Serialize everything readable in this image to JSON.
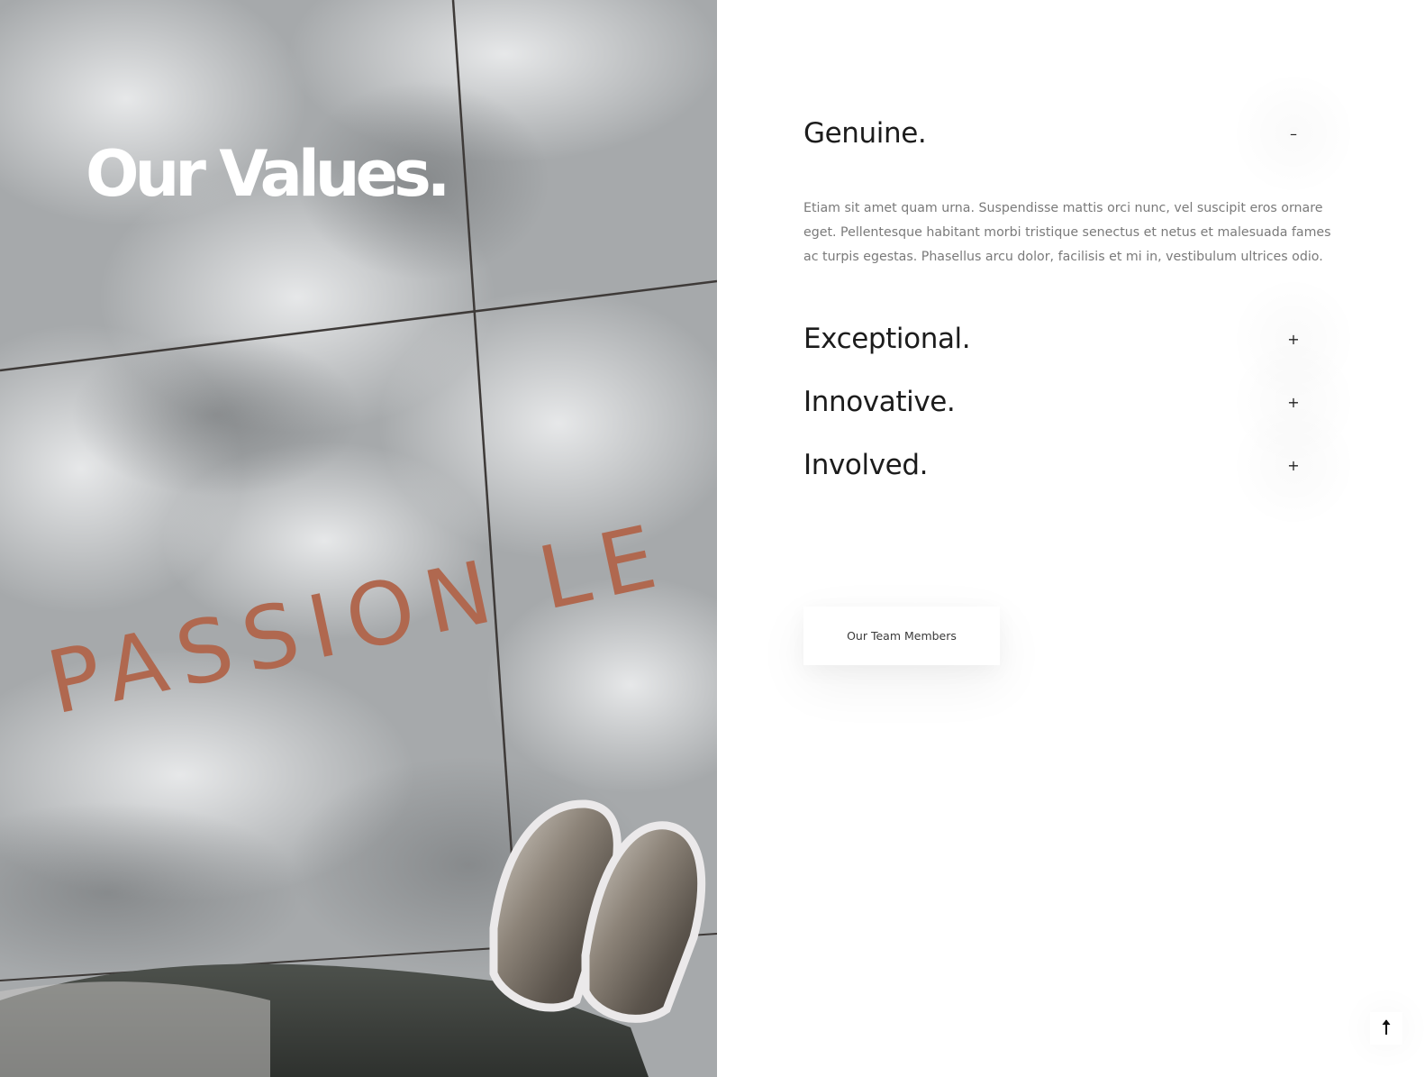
{
  "hero": {
    "title": "Our Values.",
    "photo_text": "PASSION LE"
  },
  "accordion": {
    "items": [
      {
        "title": "Genuine.",
        "toggle": "–",
        "expanded": true,
        "body": "Etiam sit amet quam urna. Suspendisse mattis orci nunc, vel suscipit eros ornare eget. Pellentesque habitant morbi tristique senectus et netus et malesuada fames ac turpis egestas. Phasellus arcu dolor, facilisis et mi in, vestibulum ultrices odio."
      },
      {
        "title": "Exceptional.",
        "toggle": "+",
        "expanded": false
      },
      {
        "title": "Innovative.",
        "toggle": "+",
        "expanded": false
      },
      {
        "title": "Involved.",
        "toggle": "+",
        "expanded": false
      }
    ]
  },
  "team_button": {
    "label": "Our Team Members"
  },
  "back_to_top": {
    "icon": "arrow-up-icon"
  },
  "colors": {
    "heading": "#1c1c1c",
    "body_text": "#7a7a7a",
    "hero_text": "#ffffff",
    "photo_letters": "#b0684f"
  }
}
